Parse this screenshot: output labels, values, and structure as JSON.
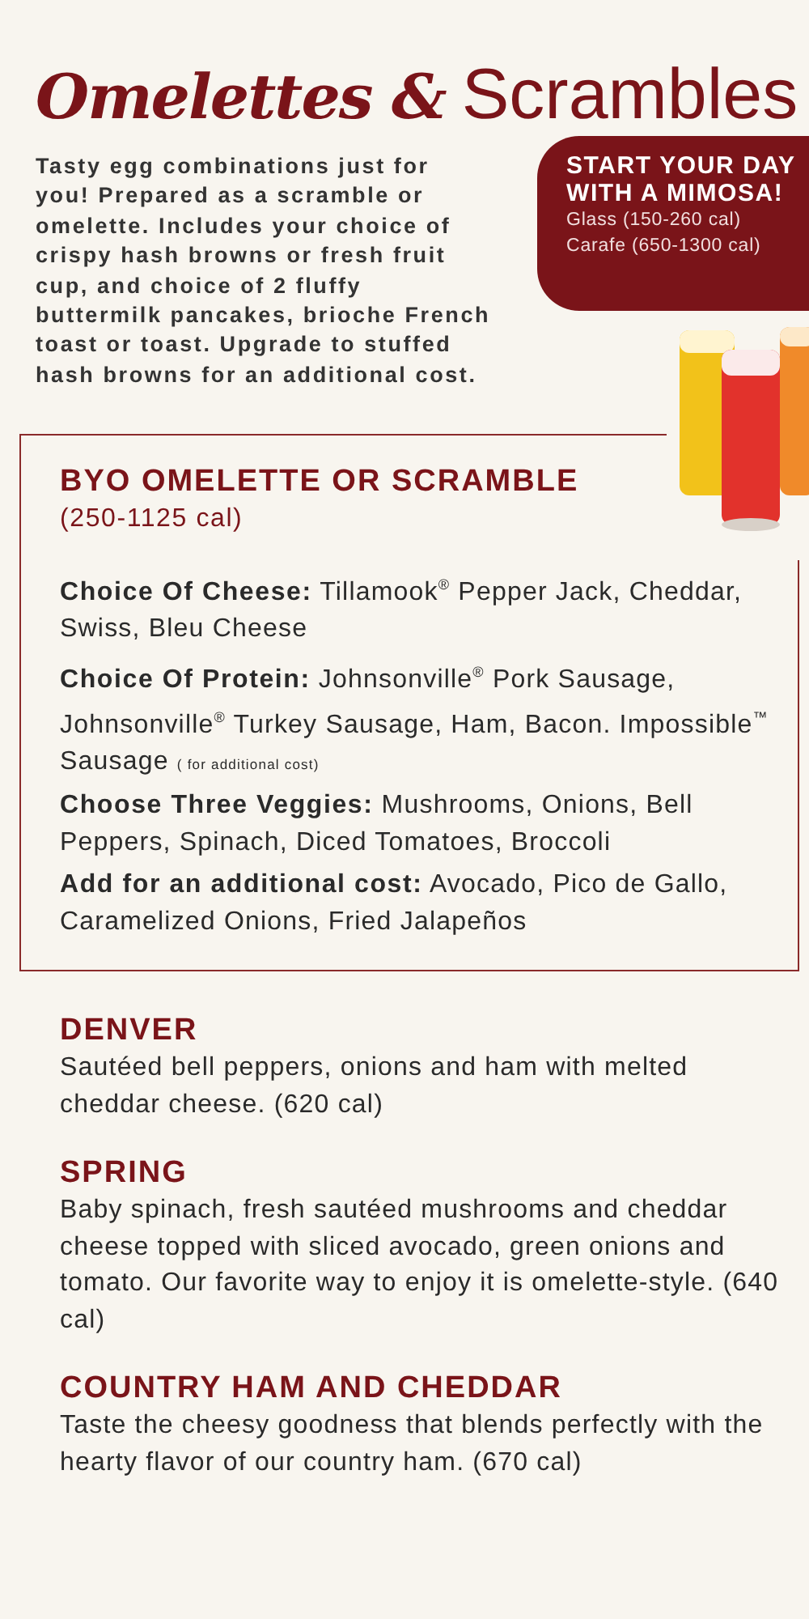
{
  "title": {
    "script": "Omelettes &",
    "main": "Scrambles"
  },
  "intro": "Tasty egg combinations just for you! Prepared as a scramble or omelette. Includes your choice of crispy hash browns or fresh fruit cup, and choice of 2 fluffy buttermilk pancakes, brioche French toast or toast. Upgrade to stuffed hash browns for an additional cost.",
  "promo": {
    "heading": "START YOUR DAY WITH A MIMOSA!",
    "lines": [
      "Glass (150-260 cal)",
      "Carafe (650-1300 cal)"
    ],
    "image": {
      "kind": "picture"
    }
  },
  "byo": {
    "title": "BYO OMELETTE OR SCRAMBLE",
    "calories": "(250-1125 cal)",
    "options": [
      {
        "label": "Choice Of Cheese:",
        "text": "Tillamook$^{®}$ Pepper Jack, Cheddar, Swiss, Bleu Cheese"
      },
      {
        "label": "Choice Of Protein:",
        "text": "Johnsonville$^{®}$ Pork Sausage, Johnsonville$^{®}$ Turkey Sausage, Ham, Bacon. Impossible$^{™}$ Sausage",
        "note": "( for additional cost)"
      },
      {
        "label": "Choose Three Veggies:",
        "text": "Mushrooms, Onions, Bell Peppers, Spinach, Diced Tomatoes, Broccoli"
      },
      {
        "label": "Add for an additional cost:",
        "text": "Avocado, Pico de Gallo, Caramelized Onions, Fried Jalapeños"
      }
    ]
  },
  "items": [
    {
      "name": "DENVER",
      "description": "Sautéed bell peppers, onions and ham with melted cheddar cheese. (620 cal)"
    },
    {
      "name": "SPRING",
      "description": "Baby spinach, fresh sautéed mushrooms and cheddar cheese topped with sliced avocado, green onions and tomato. Our favorite way to enjoy it is omelette-style. (640 cal)"
    },
    {
      "name": "COUNTRY HAM AND CHEDDAR",
      "description": "Taste the cheesy goodness that blends perfectly with the hearty flavor of our country ham. (670 cal)"
    }
  ]
}
